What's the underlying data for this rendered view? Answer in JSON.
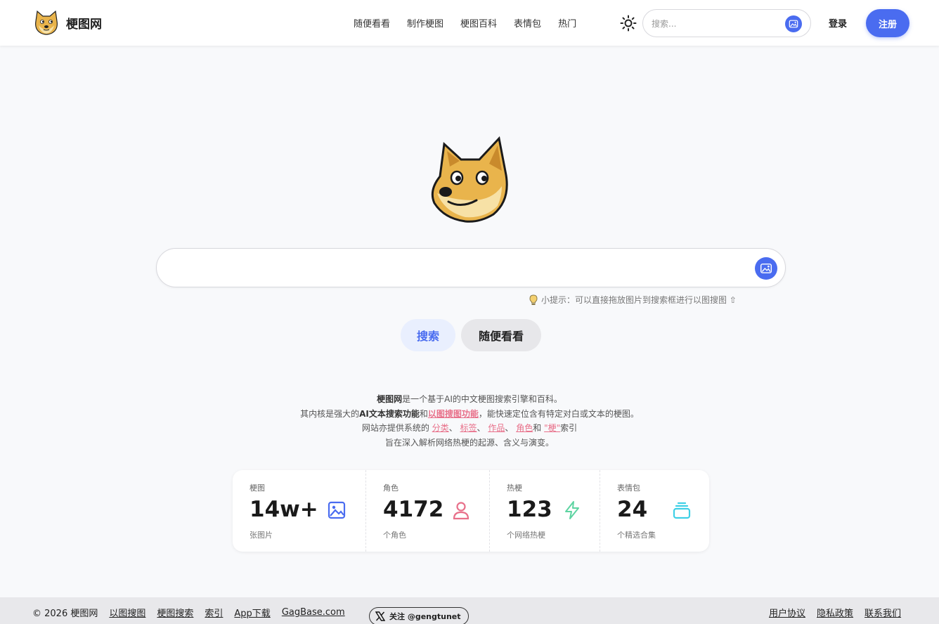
{
  "header": {
    "brand": "梗图网",
    "nav": [
      "随便看看",
      "制作梗图",
      "梗图百科",
      "表情包",
      "热门"
    ],
    "search_placeholder": "搜索...",
    "login": "登录",
    "register": "注册"
  },
  "hero": {
    "search_value": "",
    "tip": "小提示：可以直接拖放图片到搜索框进行以图搜图 ⇧",
    "search_btn": "搜索",
    "random_btn": "随便看看"
  },
  "desc": {
    "l1_site": "梗图网",
    "l1_rest": "是一个基于AI的中文梗图搜索引擎和百科。",
    "l2_a": "其内核是强大的",
    "l2_b": "AI文本搜索功能",
    "l2_c": "和",
    "l2_d": "以图搜图功能",
    "l2_e": "，能快速定位含有特定对白或文本的梗图。",
    "l3_a": "网站亦提供系统的",
    "l3_cat": "分类",
    "sep": "、",
    "l3_tag": "标签",
    "l3_work": "作品",
    "l3_role": "角色",
    "l3_and": "和",
    "l3_geng": "\"梗\"",
    "l3_end": "索引",
    "l4": "旨在深入解析网络热梗的起源、含义与演变。"
  },
  "stats": [
    {
      "label": "梗图",
      "value": "14w+",
      "sub": "张图片",
      "icon": "image-icon",
      "color": "#4a6cf0"
    },
    {
      "label": "角色",
      "value": "4172",
      "sub": "个角色",
      "icon": "user-icon",
      "color": "#e8708a"
    },
    {
      "label": "热梗",
      "value": "123",
      "sub": "个网络热梗",
      "icon": "lightning-icon",
      "color": "#5ed4a2"
    },
    {
      "label": "表情包",
      "value": "24",
      "sub": "个精选合集",
      "icon": "stack-icon",
      "color": "#3fd0e6"
    }
  ],
  "footer": {
    "copyright": "© 2026 梗图网",
    "links": [
      "以图搜图",
      "梗图搜索",
      "索引",
      "App下载",
      "GagBase.com"
    ],
    "follow": "关注 @gengtunet",
    "right_links": [
      "用户协议",
      "隐私政策",
      "联系我们"
    ]
  },
  "colors": {
    "accent": "#4a6cf0",
    "pink": "#e8708a",
    "green": "#5ed4a2",
    "cyan": "#3fd0e6",
    "doge": "#e9b44c"
  }
}
